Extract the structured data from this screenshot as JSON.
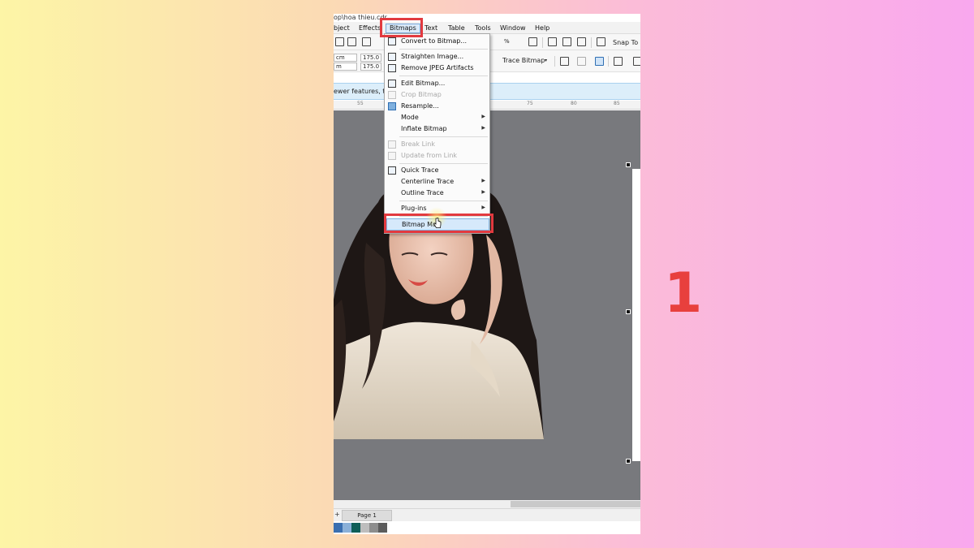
{
  "window": {
    "title_fragment": "op\\hoa thieu.cdr"
  },
  "menubar": {
    "items": [
      {
        "label": "bject"
      },
      {
        "label": "Effects"
      },
      {
        "label": "Bitmaps"
      },
      {
        "label": "Text"
      },
      {
        "label": "Table"
      },
      {
        "label": "Tools"
      },
      {
        "label": "Window"
      },
      {
        "label": "Help"
      }
    ],
    "active": "Bitmaps"
  },
  "toolbar": {
    "zoom_suffix": "%",
    "snap_to_label": "Snap To",
    "trace_bitmap_label": "Trace Bitmap",
    "unit_label_1": "cm",
    "unit_label_2": "m",
    "value_1": "175.0",
    "value_2": "175.0"
  },
  "infobar": {
    "text": "ewer features, text"
  },
  "ruler": {
    "labels": [
      "55",
      "75",
      "80",
      "85"
    ]
  },
  "bitmaps_menu": {
    "items": [
      {
        "label": "Convert to Bitmap...",
        "enabled": true,
        "submenu": false,
        "icon": "convert-bitmap-icon"
      },
      {
        "label": "Straighten Image...",
        "enabled": true,
        "submenu": false,
        "icon": "straighten-icon"
      },
      {
        "label": "Remove JPEG Artifacts",
        "enabled": true,
        "submenu": false,
        "icon": "jpeg-artifacts-icon"
      },
      {
        "label": "Edit Bitmap...",
        "enabled": true,
        "submenu": false,
        "icon": "edit-bitmap-icon"
      },
      {
        "label": "Crop Bitmap",
        "enabled": false,
        "submenu": false,
        "icon": "crop-icon"
      },
      {
        "label": "Resample...",
        "enabled": true,
        "submenu": false,
        "icon": "resample-icon"
      },
      {
        "label": "Mode",
        "enabled": true,
        "submenu": true,
        "icon": ""
      },
      {
        "label": "Inflate Bitmap",
        "enabled": true,
        "submenu": true,
        "icon": ""
      },
      {
        "label": "Break Link",
        "enabled": false,
        "submenu": false,
        "icon": "break-link-icon"
      },
      {
        "label": "Update from Link",
        "enabled": false,
        "submenu": false,
        "icon": "update-link-icon"
      },
      {
        "label": "Quick Trace",
        "enabled": true,
        "submenu": false,
        "icon": "quick-trace-icon"
      },
      {
        "label": "Centerline Trace",
        "enabled": true,
        "submenu": true,
        "icon": ""
      },
      {
        "label": "Outline Trace",
        "enabled": true,
        "submenu": true,
        "icon": ""
      },
      {
        "label": "Plug-ins",
        "enabled": true,
        "submenu": true,
        "icon": ""
      },
      {
        "label": "Bitmap Mas",
        "enabled": true,
        "submenu": false,
        "icon": "",
        "highlighted": true
      }
    ]
  },
  "pages": {
    "tab_label": "Page 1",
    "add_label": "+"
  },
  "palette": [
    "#3a6fb0",
    "#8ab0d8",
    "#0e5e58",
    "#bdbdbd",
    "#8d8d8d",
    "#5c5c5c"
  ],
  "step_number": "1",
  "colors": {
    "highlight_box": "#e23a3f",
    "canvas": "#78797d",
    "step": "#e8403d"
  }
}
